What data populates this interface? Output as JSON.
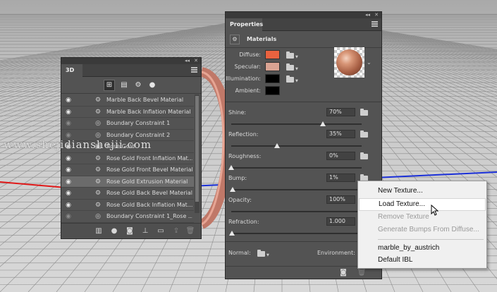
{
  "panel_3d": {
    "title": "3D",
    "filters": [
      {
        "name": "scene-filter-icon",
        "glyph": "⊞"
      },
      {
        "name": "mesh-filter-icon",
        "glyph": "▤"
      },
      {
        "name": "material-filter-icon",
        "glyph": "⚙"
      },
      {
        "name": "light-filter-icon",
        "glyph": "●"
      }
    ],
    "layers": [
      {
        "label": "Marble Back Bevel Material",
        "icon": "material",
        "visible": true
      },
      {
        "label": "Marble Back Inflation Material",
        "icon": "material",
        "visible": true
      },
      {
        "label": "Boundary Constraint 1",
        "icon": "constraint",
        "visible": false
      },
      {
        "label": "Boundary Constraint 2",
        "icon": "constraint",
        "visible": false
      },
      {
        "label": "Rose Gold",
        "icon": "mesh",
        "visible": true
      },
      {
        "label": "Rose Gold Front Inflation Mat...",
        "icon": "material",
        "visible": true
      },
      {
        "label": "Rose Gold Front Bevel Material",
        "icon": "material",
        "visible": true
      },
      {
        "label": "Rose Gold Extrusion Material",
        "icon": "material",
        "visible": true,
        "selected": true
      },
      {
        "label": "Rose Gold Back Bevel Material",
        "icon": "material",
        "visible": true
      },
      {
        "label": "Rose Gold Back Inflation Mat...",
        "icon": "material",
        "visible": true
      },
      {
        "label": "Boundary Constraint 1_Rose ...",
        "icon": "constraint",
        "visible": false
      }
    ]
  },
  "properties": {
    "title": "Properties",
    "section_title": "Materials",
    "diffuse_label": "Diffuse:",
    "specular_label": "Specular:",
    "illumination_label": "Illumination:",
    "ambient_label": "Ambient:",
    "diffuse_color": "#e9623f",
    "specular_color": "#d9a393",
    "illumination_color": "#000000",
    "ambient_color": "#000000",
    "shine_label": "Shine:",
    "shine_value": "70%",
    "shine_level": 0.7,
    "reflection_label": "Reflection:",
    "reflection_value": "35%",
    "reflection_level": 0.35,
    "roughness_label": "Roughness:",
    "roughness_value": "0%",
    "roughness_level": 0.0,
    "bump_label": "Bump:",
    "bump_value": "1%",
    "bump_level": 0.01,
    "opacity_label": "Opacity:",
    "opacity_value": "100%",
    "refraction_label": "Refraction:",
    "refraction_value": "1.000",
    "normal_label": "Normal:",
    "environment_label": "Environment:"
  },
  "context_menu": {
    "new_texture": "New Texture...",
    "load_texture": "Load Texture...",
    "remove_texture": "Remove Texture",
    "generate_bumps": "Generate Bumps From Diffuse...",
    "marble": "marble_by_austrich",
    "default_ibl": "Default IBL"
  },
  "watermark": "www.shejidianshejii.com"
}
